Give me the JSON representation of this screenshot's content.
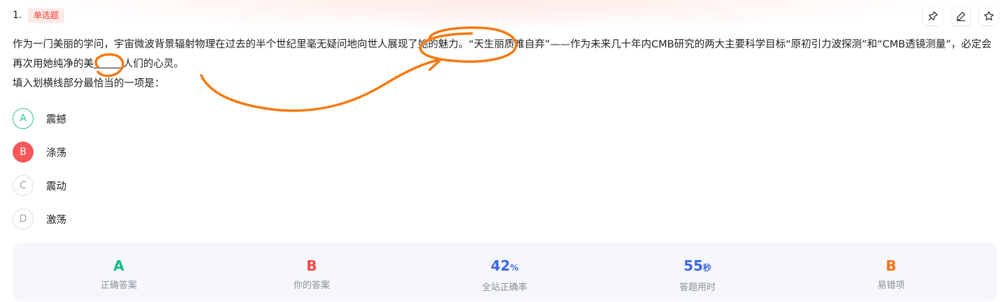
{
  "question": {
    "number": "1.",
    "type_tag": "单选题",
    "stem_part1": "作为一门美丽的学问，宇宙微波背景辐射物理在过去的半个世纪里毫无疑问地向世人展现了她的魅力。“天生丽质难自弃”——作为未来几十年内CMB研究的两大主要科学目标“原初引力波探测”和“CMB透镜测量”，必定会再次用她纯净的美",
    "stem_part2": "人们的心灵。",
    "prompt": "填入划横线部分最恰当的一项是："
  },
  "toolbar": {
    "pin_icon": "pin-icon",
    "edit_icon": "edit-icon",
    "star_icon": "star-icon"
  },
  "options": [
    {
      "letter": "A",
      "text": "震撼",
      "state": "correct"
    },
    {
      "letter": "B",
      "text": "涤荡",
      "state": "selected-wrong"
    },
    {
      "letter": "C",
      "text": "震动",
      "state": "plain"
    },
    {
      "letter": "D",
      "text": "激荡",
      "state": "plain"
    }
  ],
  "stats": {
    "correct_answer": {
      "value": "A",
      "label": "正确答案",
      "color": "#17b987"
    },
    "your_answer": {
      "value": "B",
      "label": "你的答案",
      "color": "#f2474a"
    },
    "accuracy": {
      "value": "42",
      "unit": "%",
      "label": "全站正确率",
      "color": "#3a66e6"
    },
    "time_used": {
      "value": "55",
      "unit": "秒",
      "label": "答题用时",
      "color": "#3a66e6"
    },
    "common_wrong": {
      "value": "B",
      "label": "易错项",
      "color": "#f97316"
    }
  },
  "colors": {
    "annotation": "#f47a10",
    "type_tag_bg": "#fde9e7",
    "type_tag_text": "#ee3d2f"
  }
}
